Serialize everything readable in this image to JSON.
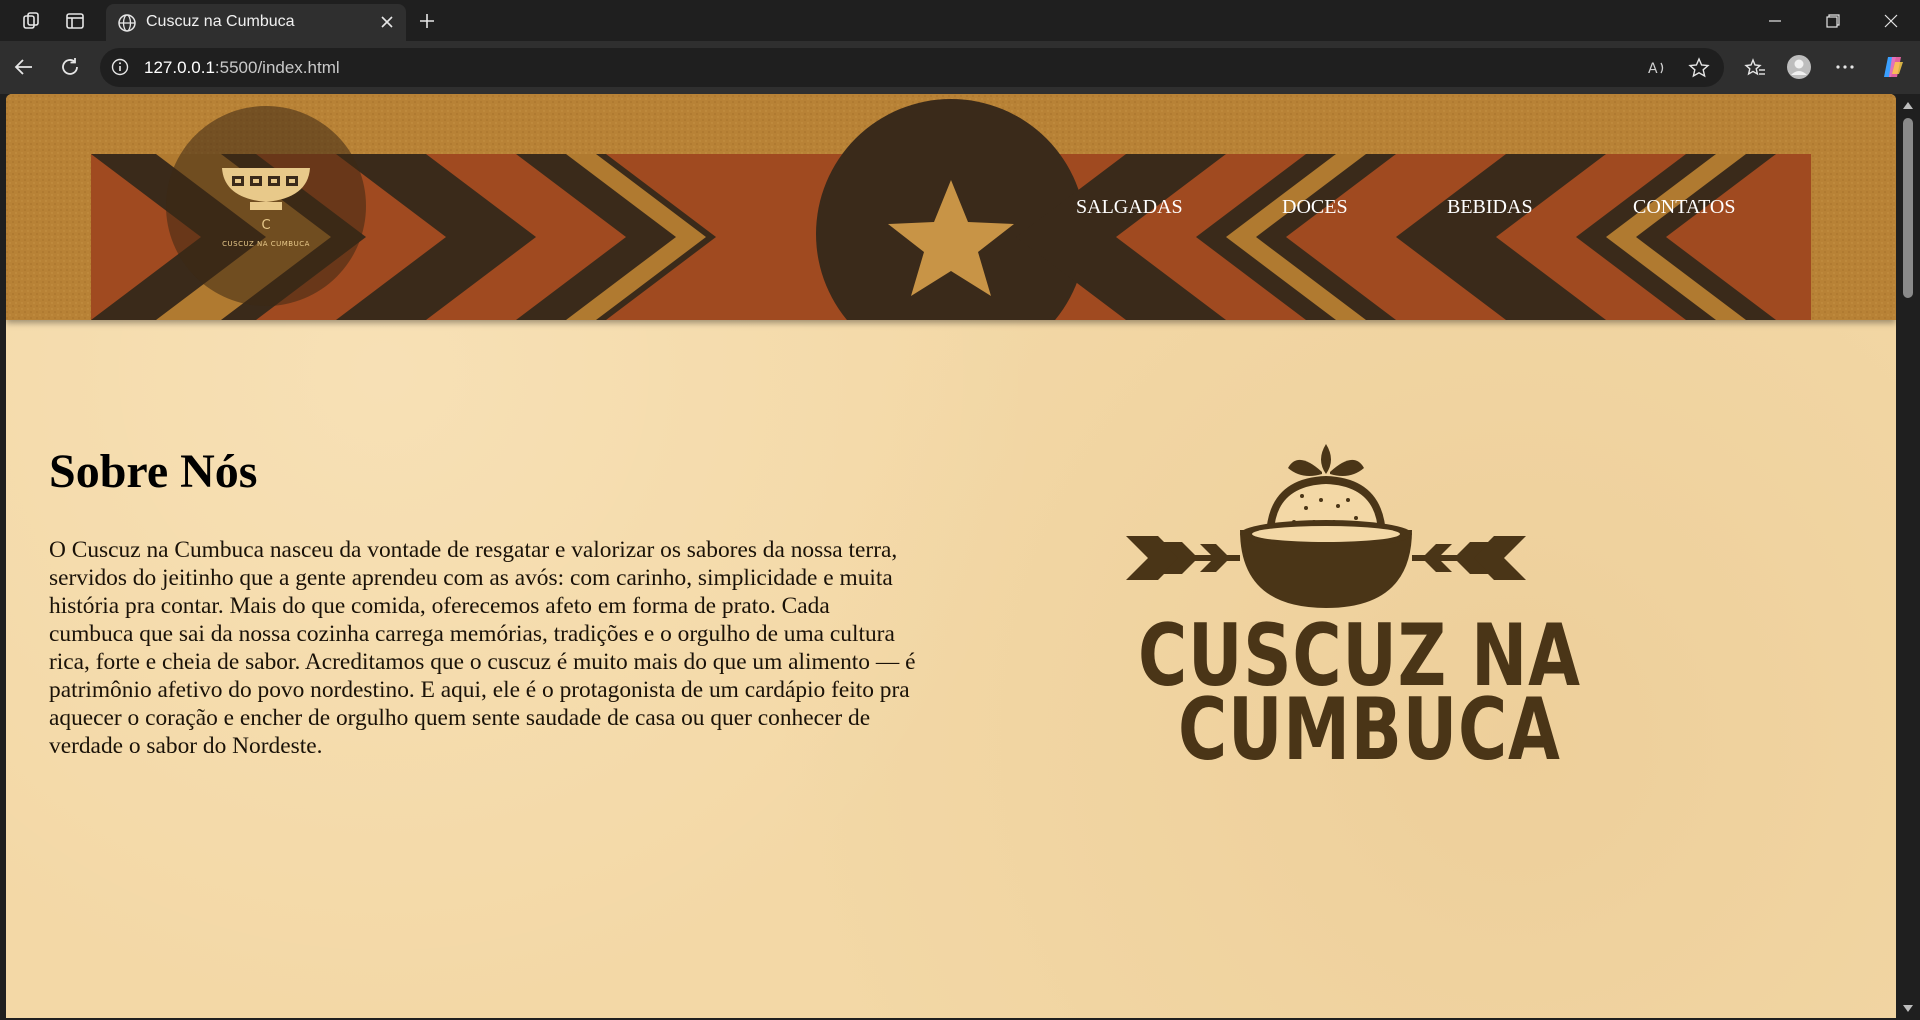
{
  "browser": {
    "tab_title": "Cuscuz na Cumbuca",
    "url_host": "127.0.0.1",
    "url_rest": ":5500/index.html"
  },
  "site": {
    "logo_letter": "C",
    "logo_text": "CUSCUZ NA CUMBUCA",
    "nav": [
      "SALGADAS",
      "DOCES",
      "BEBIDAS",
      "CONTATOS"
    ]
  },
  "about": {
    "title": "Sobre Nós",
    "text": "O Cuscuz na Cumbuca nasceu da vontade de resgatar e valorizar os sabores da nossa terra, servidos do jeitinho que a gente aprendeu com as avós: com carinho, simplicidade e muita história pra contar. Mais do que comida, oferecemos afeto em forma de prato. Cada cumbuca que sai da nossa cozinha carrega memórias, tradições e o orgulho de uma cultura rica, forte e cheia de sabor. Acreditamos que o cuscuz é muito mais do que um alimento — é patrimônio afetivo do povo nordestino. E aqui, ele é o protagonista de um cardápio feito pra aquecer o coração e encher de orgulho quem sente saudade de casa ou quer conhecer de verdade o sabor do Nordeste."
  },
  "brand": {
    "line1": "CUSCUZ NA",
    "line2": "CUMBUCA"
  },
  "colors": {
    "page_bg": "#f3d8a6",
    "banner_ochre": "#b07a30",
    "banner_dark": "#3a2a1a",
    "banner_rust": "#a04a20",
    "brand_brown": "#4a3517"
  }
}
